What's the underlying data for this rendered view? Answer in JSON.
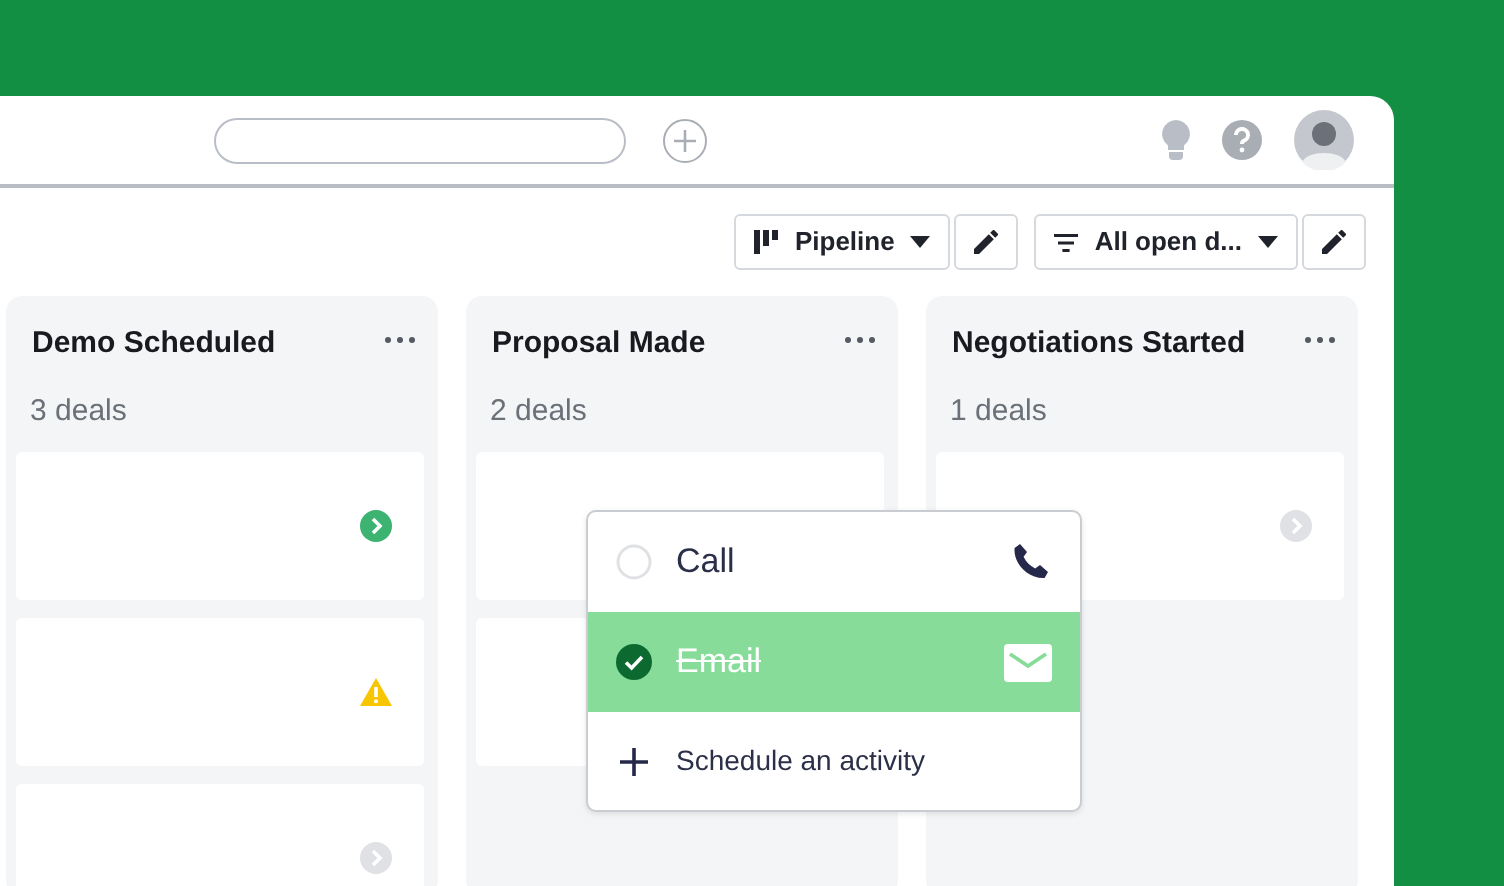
{
  "toolbar": {
    "view": {
      "label": "Pipeline"
    },
    "filter": {
      "label": "All open d..."
    }
  },
  "stages": [
    {
      "title": "Demo Scheduled",
      "count": "3 deals",
      "deals": [
        {
          "kind": "next"
        },
        {
          "kind": "warning"
        },
        {
          "kind": "idle"
        }
      ]
    },
    {
      "title": "Proposal Made",
      "count": "2 deals",
      "deals": [
        {
          "kind": "plain"
        },
        {
          "kind": "plain"
        }
      ]
    },
    {
      "title": "Negotiations Started",
      "count": "1 deals",
      "deals": [
        {
          "kind": "idle"
        }
      ]
    }
  ],
  "activity_menu": {
    "items": [
      {
        "kind": "call",
        "label": "Call",
        "checked": false,
        "selected": false
      },
      {
        "kind": "email",
        "label": "Email",
        "checked": true,
        "selected": true
      }
    ],
    "action": {
      "label": "Schedule an activity"
    }
  }
}
